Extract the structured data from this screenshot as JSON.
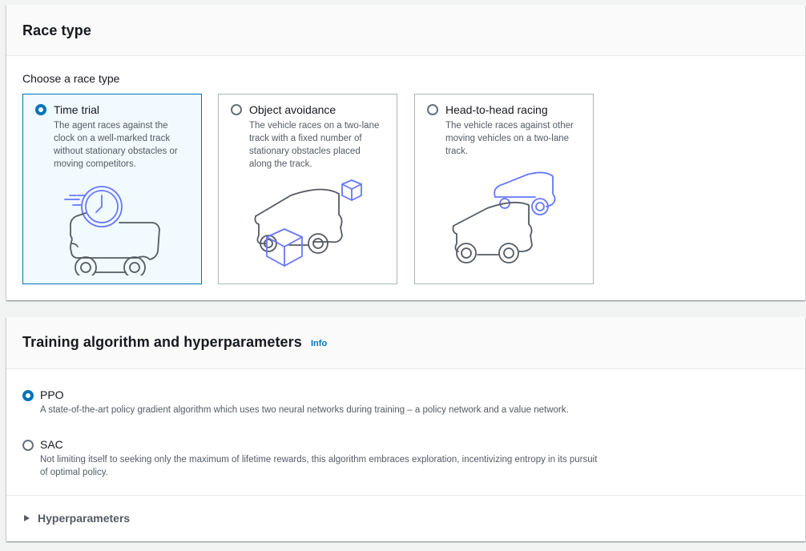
{
  "race_type": {
    "title": "Race type",
    "choose_label": "Choose a race type",
    "options": [
      {
        "label": "Time trial",
        "description": "The agent races against the clock on a well-marked track without stationary obstacles or moving competitors.",
        "selected": true,
        "illustration": "car-clock-icon"
      },
      {
        "label": "Object avoidance",
        "description": "The vehicle races on a two-lane track with a fixed number of stationary obstacles placed along the track.",
        "selected": false,
        "illustration": "car-boxes-icon"
      },
      {
        "label": "Head-to-head racing",
        "description": "The vehicle races against other moving vehicles on a two-lane track.",
        "selected": false,
        "illustration": "two-cars-icon"
      }
    ]
  },
  "training": {
    "title": "Training algorithm and hyperparameters",
    "info_label": "Info",
    "algorithms": [
      {
        "label": "PPO",
        "description": "A state-of-the-art policy gradient algorithm which uses two neural networks during training – a policy network and a value network.",
        "selected": true
      },
      {
        "label": "SAC",
        "description": "Not limiting itself to seeking only the maximum of lifetime rewards, this algorithm embraces exploration, incentivizing entropy in its pursuit of optimal policy.",
        "selected": false
      }
    ],
    "hyperparameters_label": "Hyperparameters"
  },
  "colors": {
    "accent": "#0073bb",
    "selected_tile_bg": "#f1faff",
    "illustration_blue": "#6677ff",
    "illustration_gray": "#545b64"
  }
}
